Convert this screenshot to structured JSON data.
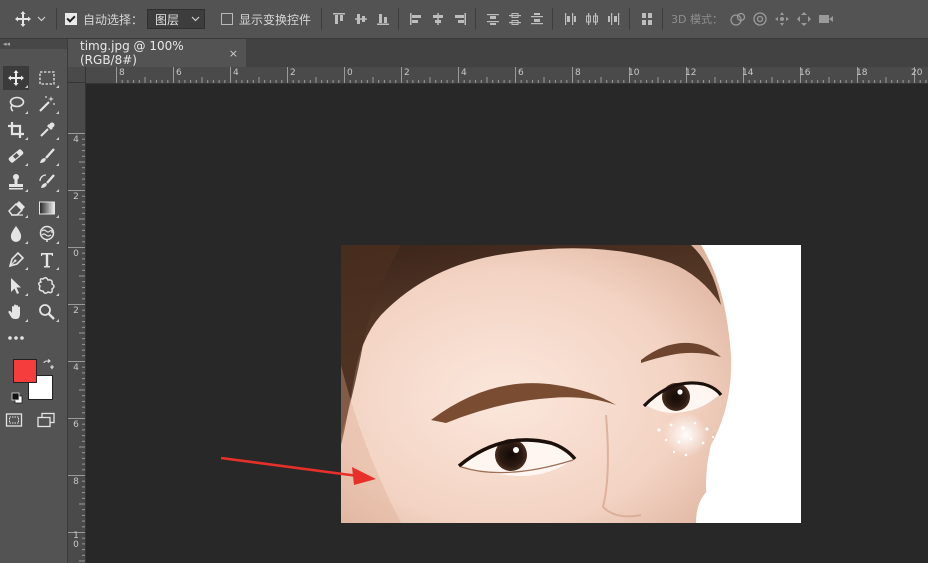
{
  "options_bar": {
    "auto_select_label": "自动选择：",
    "auto_select_checked": true,
    "auto_select_target": "图层",
    "show_transform_label": "显示变换控件",
    "show_transform_checked": false,
    "mode_3d_label": "3D 模式："
  },
  "document": {
    "tab_title": "timg.jpg @ 100%(RGB/8#)",
    "close_glyph": "×"
  },
  "rulers": {
    "top_labels": [
      "8",
      "6",
      "4",
      "2",
      "0",
      "2",
      "4",
      "6",
      "8",
      "10",
      "12",
      "14",
      "16",
      "18",
      "20"
    ],
    "left_labels": [
      "4",
      "2",
      "0",
      "2",
      "4",
      "6",
      "8",
      "1\n0"
    ]
  },
  "colors": {
    "foreground": "#f53d3d",
    "background": "#ffffff",
    "ui_panel": "#535353",
    "canvas": "#282828",
    "arrow": "#e8302a"
  },
  "tools": [
    {
      "name": "move-tool-icon"
    },
    {
      "name": "marquee-tool-icon"
    },
    {
      "name": "lasso-tool-icon"
    },
    {
      "name": "magic-wand-tool-icon"
    },
    {
      "name": "crop-tool-icon"
    },
    {
      "name": "eyedropper-tool-icon"
    },
    {
      "name": "healing-brush-tool-icon"
    },
    {
      "name": "brush-tool-icon"
    },
    {
      "name": "clone-stamp-tool-icon"
    },
    {
      "name": "history-brush-tool-icon"
    },
    {
      "name": "eraser-tool-icon"
    },
    {
      "name": "gradient-tool-icon"
    },
    {
      "name": "blur-tool-icon"
    },
    {
      "name": "dodge-tool-icon"
    },
    {
      "name": "pen-tool-icon"
    },
    {
      "name": "type-tool-icon"
    },
    {
      "name": "path-selection-tool-icon"
    },
    {
      "name": "custom-shape-tool-icon"
    },
    {
      "name": "hand-tool-icon"
    },
    {
      "name": "zoom-tool-icon"
    },
    {
      "name": "more-tools-icon"
    }
  ]
}
